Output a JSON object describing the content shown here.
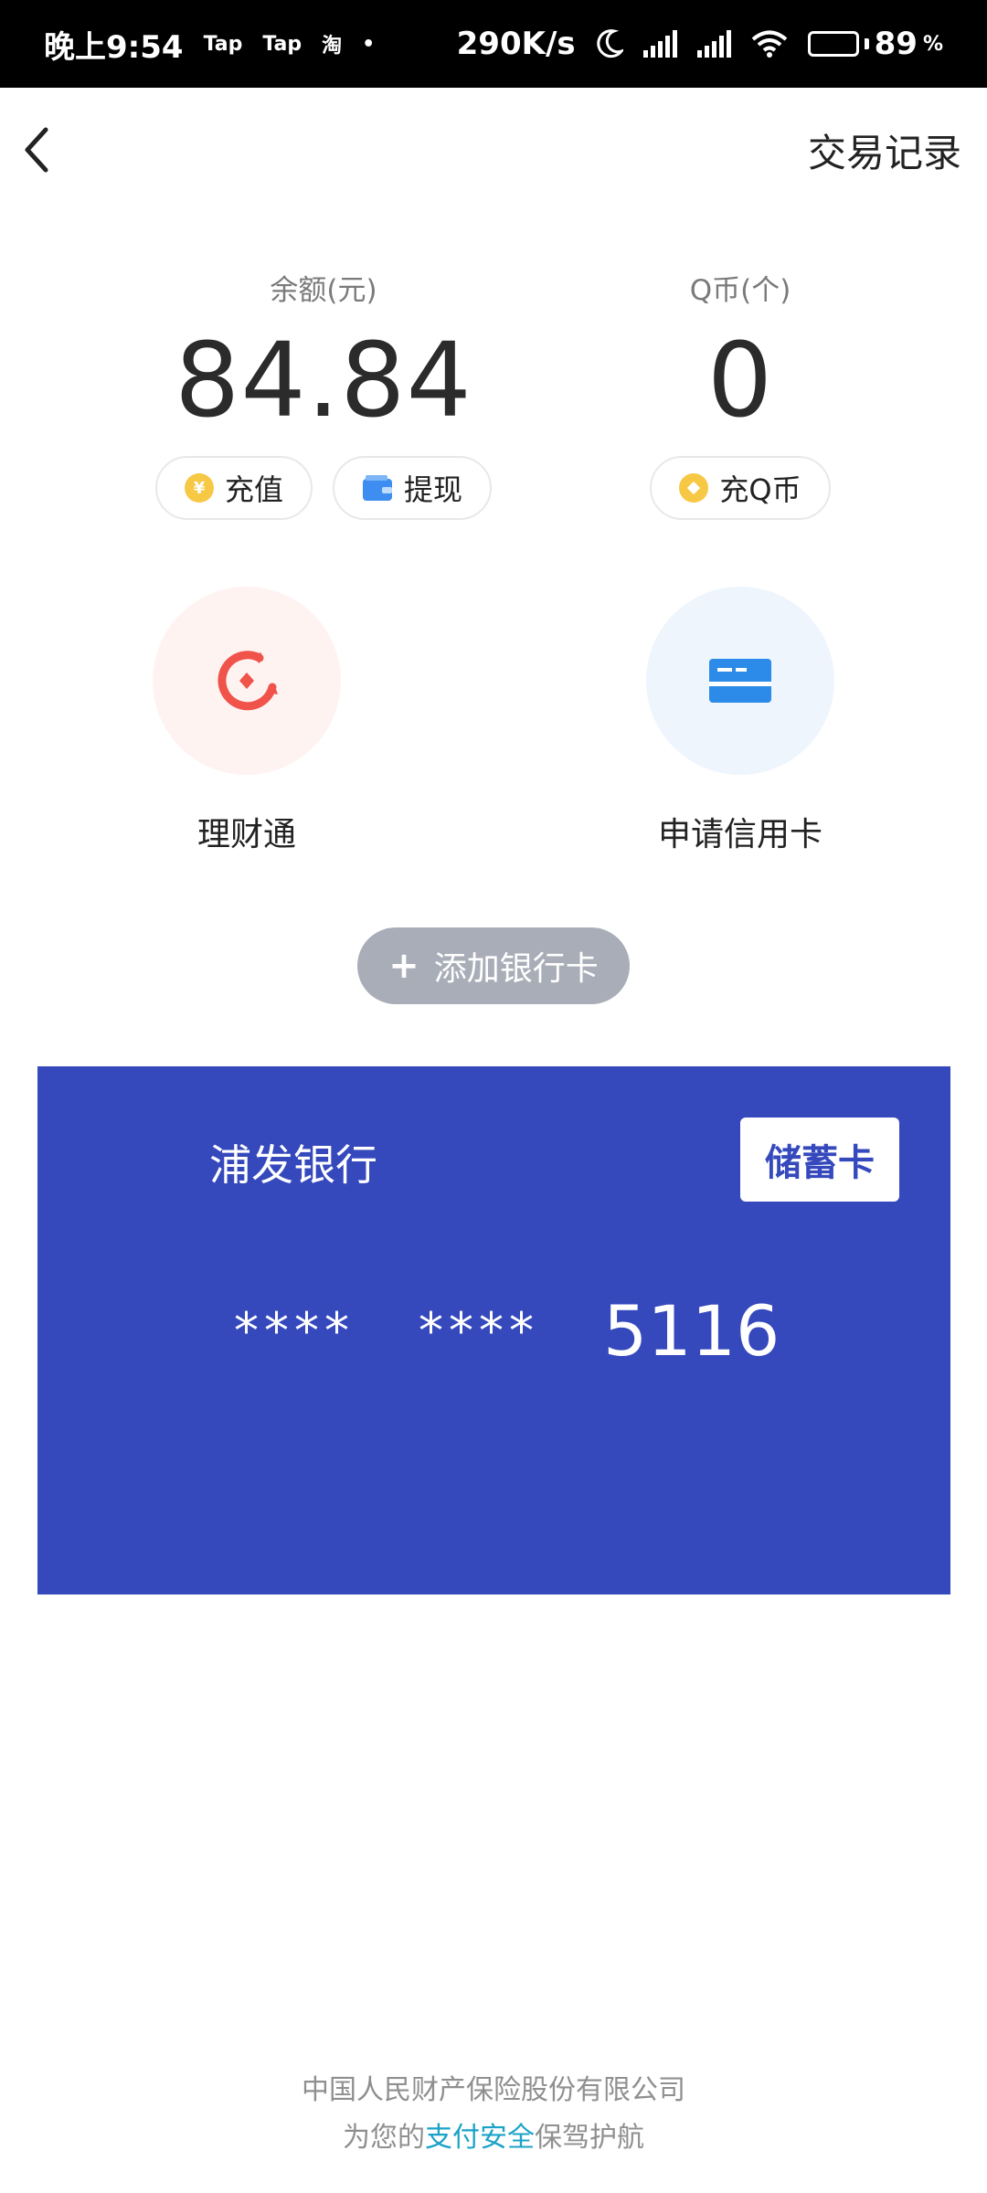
{
  "status_bar": {
    "time": "晚上9:54",
    "notif_1": "Tap",
    "notif_2": "Tap",
    "notif_3": "淘",
    "dot": "•",
    "net_speed": "290K/s",
    "battery": "89",
    "battery_unit": "%"
  },
  "header": {
    "transaction_records": "交易记录"
  },
  "balance": {
    "label": "余额(元)",
    "value": "84.84",
    "recharge_label": "充值",
    "withdraw_label": "提现",
    "recharge_icon_glyph": "¥"
  },
  "qcoin": {
    "label": "Q币(个)",
    "value": "0",
    "recharge_label": "充Q币"
  },
  "services": [
    {
      "label": "理财通",
      "icon": "licaitong-icon",
      "bg": "#fff3f2"
    },
    {
      "label": "申请信用卡",
      "icon": "credit-card-icon",
      "bg": "#eef5fd"
    }
  ],
  "add_card": {
    "plus": "+",
    "label": "添加银行卡"
  },
  "bank_card": {
    "bank_name": "浦发银行",
    "card_type": "储蓄卡",
    "mask_1": "****",
    "mask_2": "****",
    "last4": "5116",
    "color": "#3549bd"
  },
  "footer": {
    "line1": "中国人民财产保险股份有限公司",
    "line2_prefix": "为您的",
    "line2_highlight": "支付安全",
    "line2_suffix": "保驾护航"
  }
}
